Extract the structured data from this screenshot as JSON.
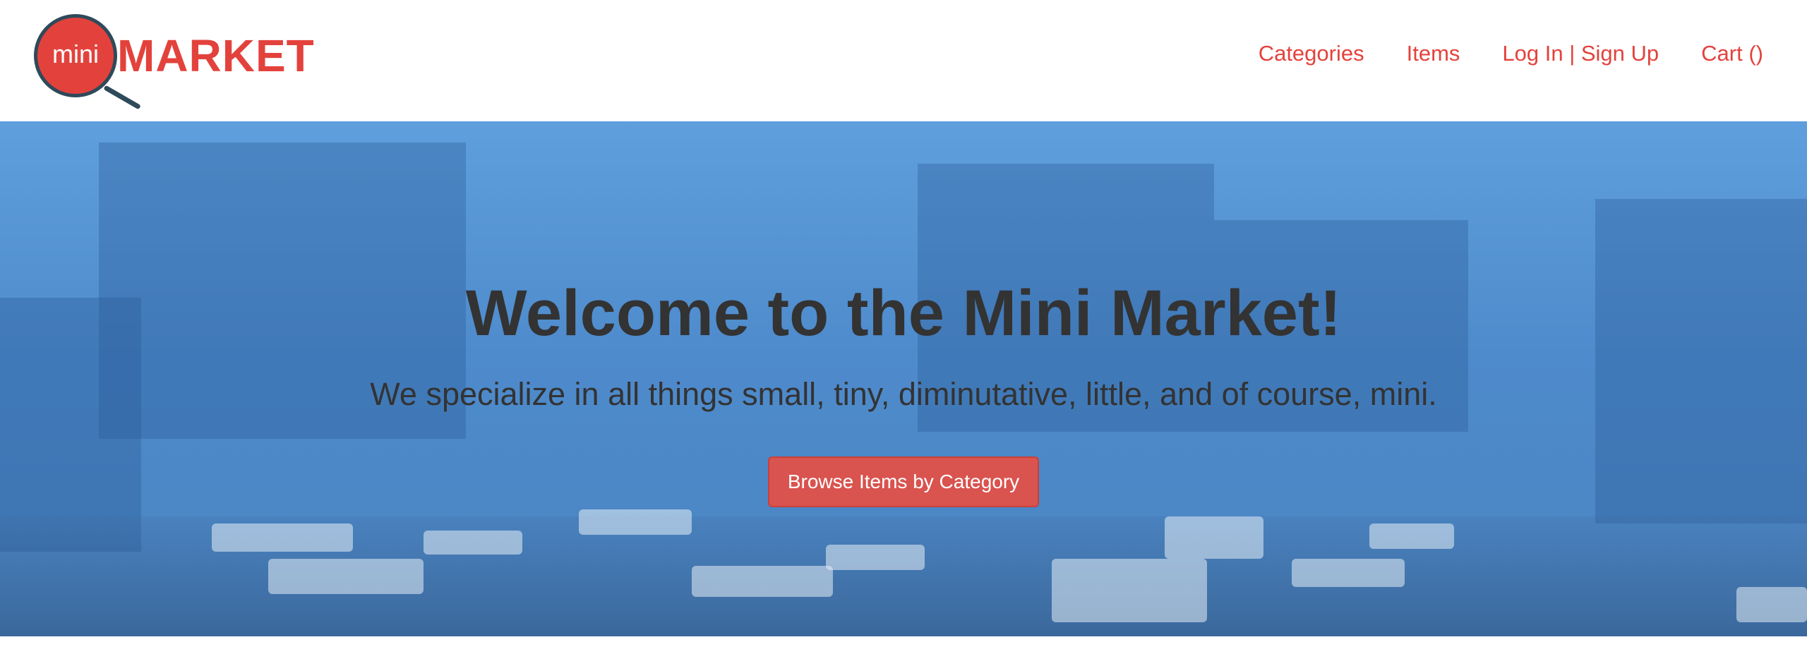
{
  "logo": {
    "mini": "mini",
    "market": "MARKET"
  },
  "nav": {
    "categories": "Categories",
    "items": "Items",
    "login": "Log In | Sign Up",
    "cart": "Cart ()"
  },
  "hero": {
    "title": "Welcome to the Mini Market!",
    "subtitle": "We specialize in all things small, tiny, diminutative, little, and of course, mini.",
    "button_label": "Browse Items by Category"
  },
  "colors": {
    "brand_red": "#e3423c",
    "button_red": "#d9534f",
    "hero_blue": "#5f9fdd",
    "text_dark": "#333333"
  }
}
